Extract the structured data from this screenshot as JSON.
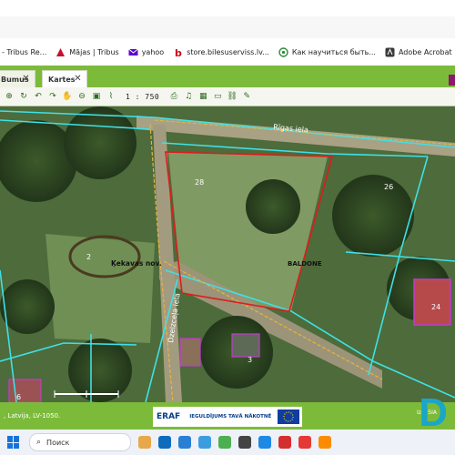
{
  "bookmarks": [
    {
      "label": "- Tribus Re...",
      "icon": "tribus-icon"
    },
    {
      "label": "Mājas | Tribus",
      "icon": "tribus-icon"
    },
    {
      "label": "yahoo",
      "icon": "yahoo-mail-icon"
    },
    {
      "label": "store.bilesuserviss.lv...",
      "icon": "bilesu-serviss-icon"
    },
    {
      "label": "Как научиться быть...",
      "icon": "globe-icon"
    },
    {
      "label": "Adobe Acrobat",
      "icon": "adobe-acrobat-icon"
    }
  ],
  "app": {
    "tabs": [
      {
        "label": "Bumus",
        "close": "✕"
      },
      {
        "label": "Kartes",
        "close": "✕"
      }
    ]
  },
  "toolbar": {
    "scale": "1 : 750"
  },
  "map": {
    "street_top": "Rīgas iela",
    "street_left": "Dzelzceļa iela",
    "labels": {
      "parcel_28": "28",
      "parcel_26": "26",
      "parcel_2": "2",
      "parcel_24": "24",
      "parcel_3": "3",
      "parcel_6": "6",
      "kekavas": "Ķekavas nov.",
      "baldone": "BALDONE"
    },
    "colors": {
      "boundary_cyan": "#3fe0e6",
      "selected_parcel": "#e01b1b",
      "road_yellow": "#e6b53a",
      "building_magenta": "#c23ad0"
    }
  },
  "footer": {
    "address": ", Latvija, LV-1050.",
    "eraf_logo": "ERAF",
    "slogan": "IEGULDĪJUMS TAVĀ NĀKOTNĒ",
    "corner_text": "Izst\nSIA"
  },
  "taskbar": {
    "search_placeholder": "Поиск"
  },
  "watermark": "D"
}
